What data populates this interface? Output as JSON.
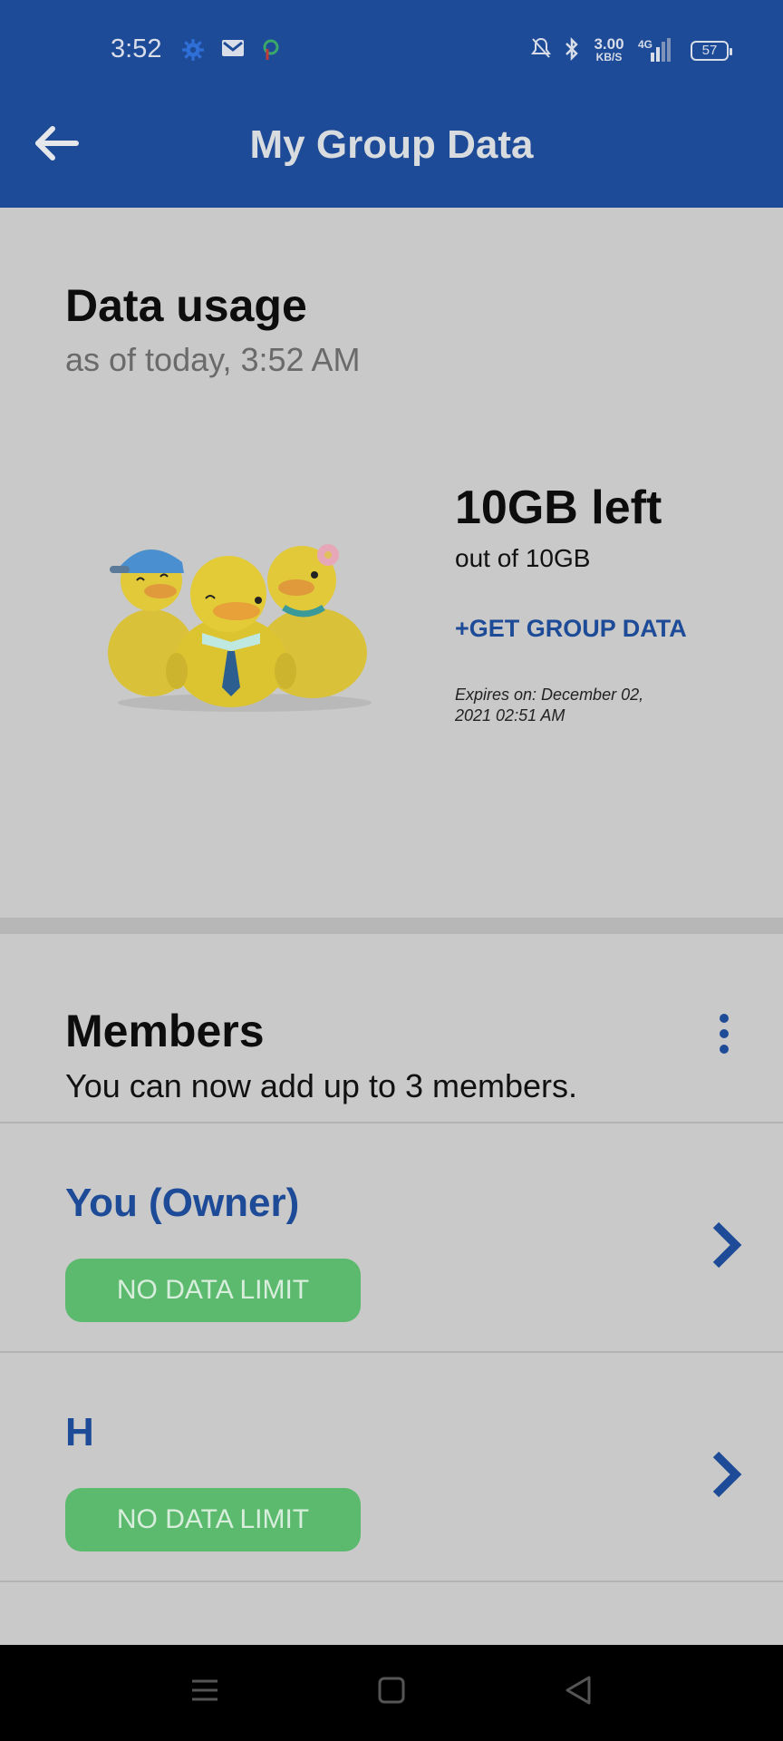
{
  "status_bar": {
    "time": "3:52",
    "net_speed_value": "3.00",
    "net_speed_unit": "KB/S",
    "network": "4G",
    "battery": "57"
  },
  "header": {
    "title": "My Group Data"
  },
  "usage": {
    "title": "Data usage",
    "subtitle": "as of today, 3:52 AM",
    "remaining": "10GB left",
    "total": "out of 10GB",
    "get_data_label": "+GET GROUP DATA",
    "expires": "Expires on: December 02, 2021 02:51 AM"
  },
  "members": {
    "title": "Members",
    "subtitle": "You can now add up to 3 members.",
    "list": [
      {
        "name": "You (Owner)",
        "limit": "NO DATA LIMIT"
      },
      {
        "name": "H",
        "limit": "NO DATA LIMIT"
      }
    ]
  },
  "colors": {
    "header_bg": "#1e4b97",
    "accent": "#1e4b97",
    "badge_green": "#5cba6e",
    "page_bg": "#c9c9c9"
  }
}
